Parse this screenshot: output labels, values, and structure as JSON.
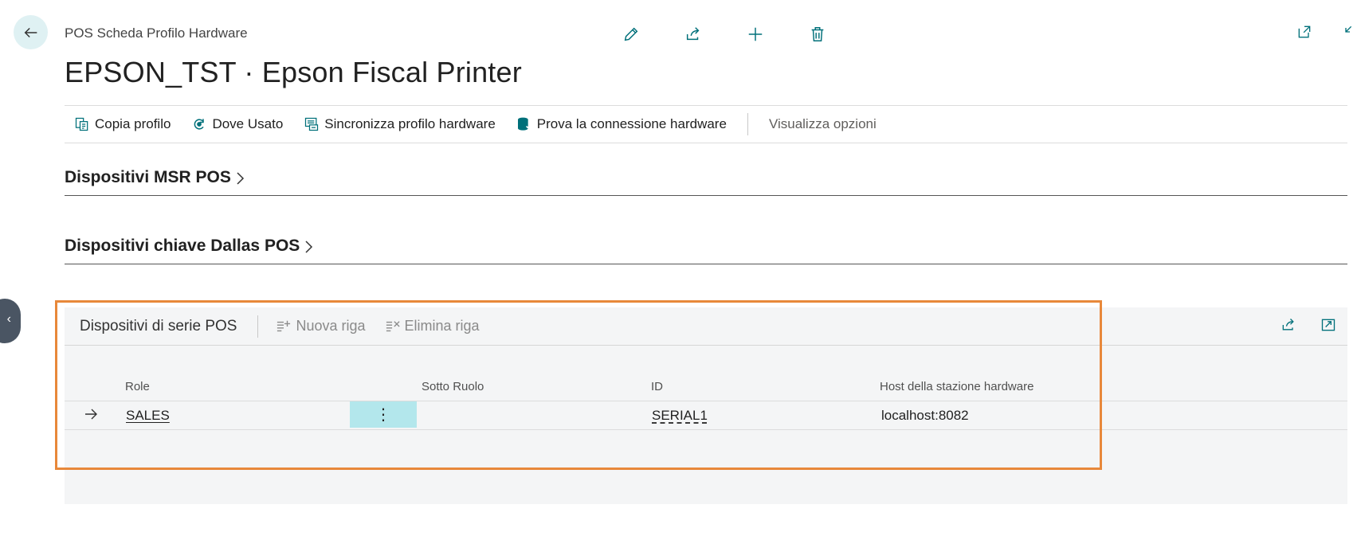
{
  "header": {
    "breadcrumb": "POS Scheda Profilo Hardware",
    "title": "EPSON_TST · Epson Fiscal Printer"
  },
  "top_actions": [
    "edit-icon",
    "share-icon",
    "add-icon",
    "delete-icon"
  ],
  "action_bar": {
    "copy_profile": "Copia profilo",
    "where_used": "Dove Usato",
    "sync_profile": "Sincronizza profilo hardware",
    "test_connection": "Prova la connessione hardware",
    "view_options": "Visualizza opzioni"
  },
  "sections": {
    "msr": "Dispositivi MSR POS",
    "dallas": "Dispositivi chiave Dallas POS"
  },
  "serial_part": {
    "title": "Dispositivi di serie POS",
    "new_row": "Nuova riga",
    "delete_row": "Elimina riga",
    "columns": {
      "role": "Role",
      "sub_role": "Sotto Ruolo",
      "id": "ID",
      "host": "Host della stazione hardware"
    },
    "rows": [
      {
        "role": "SALES",
        "sub_role": "",
        "id": "SERIAL1",
        "host": "localhost:8082"
      }
    ],
    "row_menu": "⋮"
  },
  "colors": {
    "accent": "#00707a",
    "highlight": "#e8883a",
    "selected_cell": "#b3e7ec"
  }
}
